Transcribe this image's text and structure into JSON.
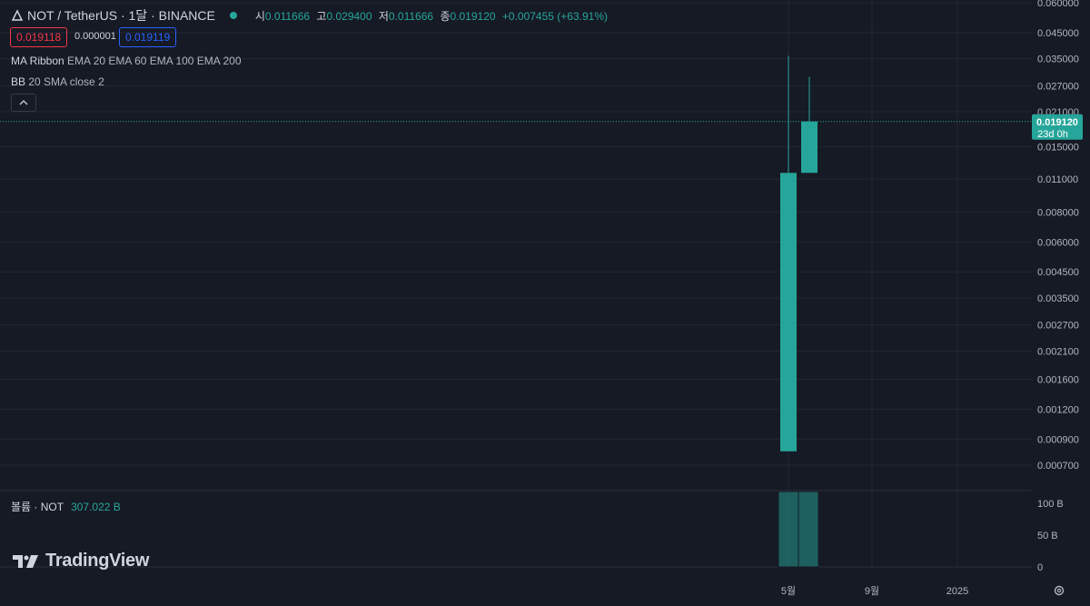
{
  "header": {
    "symbol_title": "NOT / TetherUS · 1달 · BINANCE",
    "ohlc": [
      {
        "key": "시",
        "value": "0.011666"
      },
      {
        "key": "고",
        "value": "0.029400"
      },
      {
        "key": "저",
        "value": "0.011666"
      },
      {
        "key": "종",
        "value": "0.019120"
      },
      {
        "key": "",
        "value": "+0.007455 (+63.91%)"
      }
    ],
    "bid": "0.019118",
    "spread": "0.000001",
    "ask": "0.019119"
  },
  "indicators": [
    {
      "name": "MA Ribbon",
      "params": "EMA 20 EMA 60 EMA 100 EMA 200"
    },
    {
      "name": "BB",
      "params": "20 SMA close 2"
    }
  ],
  "collapse_icon": "chevron-up-icon",
  "volume_legend": {
    "label": "볼륨 · NOT",
    "value": "307.022 B"
  },
  "logo_text": "TradingView",
  "settings_icon": "gear-icon",
  "colors": {
    "background": "#161a25",
    "up": "#26a69a",
    "down": "#f23645",
    "grid": "#232735",
    "text": "#d1d4dc"
  },
  "chart_data": {
    "type": "candlestick",
    "y_scale": "log",
    "price_ticks": [
      "0.060000",
      "0.045000",
      "0.035000",
      "0.027000",
      "0.021000",
      "0.015000",
      "0.011000",
      "0.008000",
      "0.006000",
      "0.004500",
      "0.003500",
      "0.002700",
      "0.002100",
      "0.001600",
      "0.001200",
      "0.000900",
      "0.000700"
    ],
    "x_ticks": [
      "5월",
      "9월",
      "2025"
    ],
    "candles": [
      {
        "open": 0.0008,
        "high": 0.036,
        "low": 0.0008,
        "close": 0.011666
      },
      {
        "open": 0.011666,
        "high": 0.0294,
        "low": 0.011666,
        "close": 0.01912
      }
    ],
    "last_price": {
      "value": "0.019120",
      "countdown": "23d 0h"
    },
    "volume": {
      "ticks": [
        "100 B",
        "50 B",
        "0"
      ],
      "max": 130,
      "values": [
        130,
        130
      ]
    }
  }
}
